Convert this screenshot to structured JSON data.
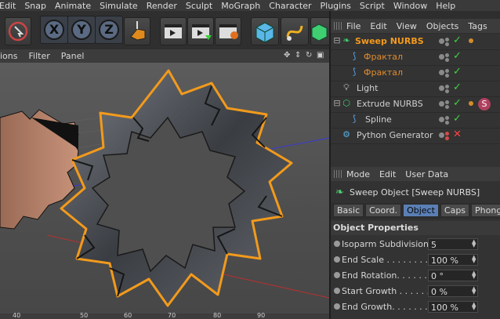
{
  "menu": [
    "Edit",
    "Snap",
    "Animate",
    "Simulate",
    "Render",
    "Sculpt",
    "MoGraph",
    "Character",
    "Plugins",
    "Script",
    "Window",
    "Help"
  ],
  "toolbar": {
    "axes": [
      "X",
      "Y",
      "Z"
    ]
  },
  "viewport_menu": [
    "ions",
    "Filter",
    "Panel"
  ],
  "ruler_ticks": [
    "40",
    "50",
    "60",
    "70",
    "80",
    "90"
  ],
  "object_manager": {
    "menu": [
      "File",
      "Edit",
      "View",
      "Objects",
      "Tags"
    ],
    "rows": [
      {
        "name": "Sweep NURBS",
        "style": "sel",
        "icon": "sweep-nurbs-icon",
        "check": "green"
      },
      {
        "name": "Фрактал",
        "style": "child",
        "icon": "spline-icon",
        "check": "green"
      },
      {
        "name": "Фрактал",
        "style": "child",
        "icon": "spline-icon",
        "check": "green"
      },
      {
        "name": "Light",
        "style": "norm",
        "icon": "light-icon",
        "check": "green"
      },
      {
        "name": "Extrude NURBS",
        "style": "norm",
        "icon": "extrude-nurbs-icon",
        "check": "green"
      },
      {
        "name": "Spline",
        "style": "norm",
        "icon": "spline-icon",
        "check": "green"
      },
      {
        "name": "Python Generator",
        "style": "norm",
        "icon": "python-generator-icon",
        "check": "red"
      }
    ]
  },
  "attribute_manager": {
    "menu": [
      "Mode",
      "Edit",
      "User Data"
    ],
    "title": "Sweep Object [Sweep NURBS]",
    "tabs": [
      "Basic",
      "Coord.",
      "Object",
      "Caps",
      "Phong"
    ],
    "active_tab": "Object",
    "section": "Object Properties",
    "props": [
      {
        "label": "Isoparm Subdivision",
        "value": "5"
      },
      {
        "label": "End Scale . . . . . . . .",
        "value": "100 %"
      },
      {
        "label": "End Rotation. . . . . . .",
        "value": "0 °"
      },
      {
        "label": "Start Growth . . . . . . .",
        "value": "0 %"
      },
      {
        "label": "End Growth. . . . . . . .",
        "value": "100 %"
      }
    ]
  },
  "colors": {
    "selection_orange": "#f59a1c",
    "active_tab": "#5a7fb5",
    "check_green": "#3fd43f",
    "check_red": "#ff4040"
  }
}
